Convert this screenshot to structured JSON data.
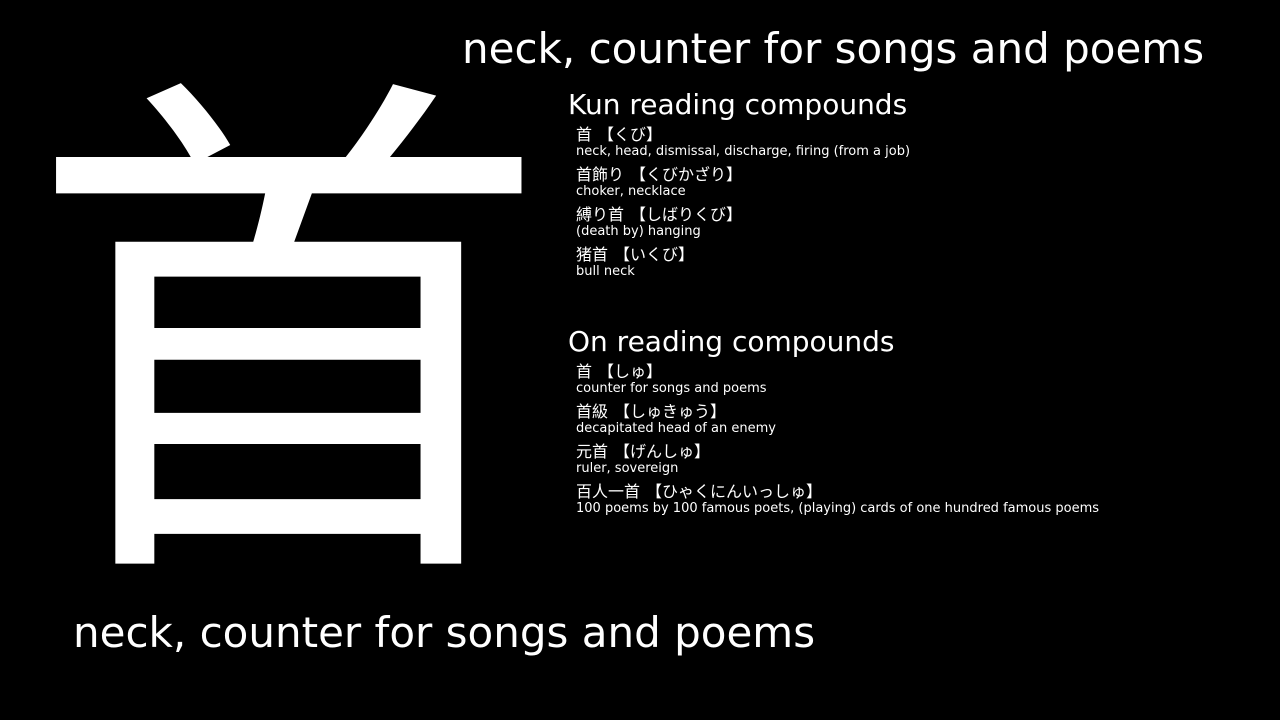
{
  "kanji": "首",
  "meaning_top": "neck, counter for songs and poems",
  "meaning_bottom": "neck, counter for songs and poems",
  "kun": {
    "title": "Kun reading compounds",
    "entries": [
      {
        "word": "首",
        "reading": "【くび】",
        "gloss": "neck, head, dismissal, discharge, firing (from a job)"
      },
      {
        "word": "首飾り",
        "reading": "【くびかざり】",
        "gloss": "choker, necklace"
      },
      {
        "word": "縛り首",
        "reading": "【しばりくび】",
        "gloss": "(death by) hanging"
      },
      {
        "word": "猪首",
        "reading": "【いくび】",
        "gloss": "bull neck"
      }
    ]
  },
  "on": {
    "title": "On reading compounds",
    "entries": [
      {
        "word": "首",
        "reading": "【しゅ】",
        "gloss": "counter for songs and poems"
      },
      {
        "word": "首級",
        "reading": "【しゅきゅう】",
        "gloss": "decapitated head of an enemy"
      },
      {
        "word": "元首",
        "reading": "【げんしゅ】",
        "gloss": "ruler, sovereign"
      },
      {
        "word": "百人一首",
        "reading": "【ひゃくにんいっしゅ】",
        "gloss": "100 poems by 100 famous poets, (playing) cards of one hundred famous poems"
      }
    ]
  },
  "colors": {
    "background": "#000000",
    "text": "#ffffff"
  }
}
